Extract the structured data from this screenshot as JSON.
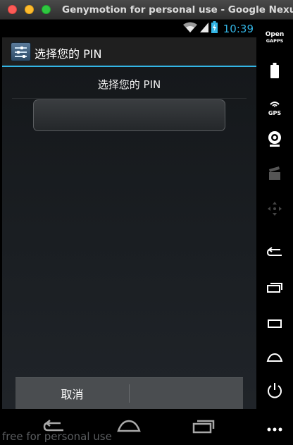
{
  "window": {
    "title": "Genymotion for personal use - Google Nexus"
  },
  "statusbar": {
    "time": "10:39"
  },
  "actionbar": {
    "title": "选择您的 PIN"
  },
  "dialog": {
    "title": "选择您的 PIN",
    "pin_input": {
      "value": "",
      "placeholder": ""
    }
  },
  "buttons": {
    "cancel": "取消",
    "continue": ""
  },
  "watermark": "free for personal use",
  "sidebar": {
    "open_gapps_line1": "Open",
    "open_gapps_line2": "GAPPS",
    "gps": "GPS"
  },
  "colors": {
    "accent": "#33b5e5",
    "action_bar": "#1f1f1f",
    "button_bar": "#4a4d50"
  }
}
